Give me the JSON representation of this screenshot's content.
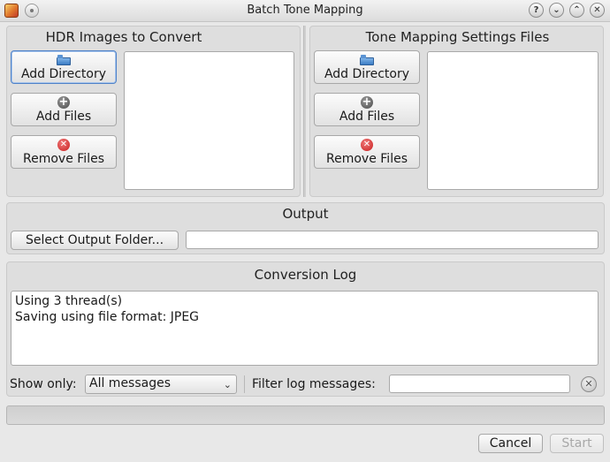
{
  "window": {
    "title": "Batch Tone Mapping"
  },
  "hdr_panel": {
    "title": "HDR Images to Convert",
    "add_directory": "Add Directory",
    "add_files": "Add Files",
    "remove_files": "Remove Files"
  },
  "tm_panel": {
    "title": "Tone Mapping Settings Files",
    "add_directory": "Add Directory",
    "add_files": "Add Files",
    "remove_files": "Remove Files"
  },
  "output": {
    "title": "Output",
    "select_folder": "Select Output Folder...",
    "folder_value": ""
  },
  "log": {
    "title": "Conversion Log",
    "lines": [
      "Using 3 thread(s)",
      "Saving using file format: JPEG"
    ],
    "show_only_label": "Show only:",
    "show_only_value": "All messages",
    "filter_label": "Filter log messages:",
    "filter_value": ""
  },
  "footer": {
    "cancel": "Cancel",
    "start": "Start"
  },
  "icons": {
    "app": "app-icon",
    "pin": "pin-icon",
    "help": "?",
    "minimize": "⌄",
    "maximize": "⌃",
    "close": "✕",
    "folder": "folder-icon",
    "add": "+",
    "remove": "✕",
    "combo_arrow": "⌄",
    "clear": "✕"
  },
  "colors": {
    "focus": "#4f82c8",
    "remove_red": "#c81e1e",
    "folder_blue": "#3b7cc4"
  }
}
